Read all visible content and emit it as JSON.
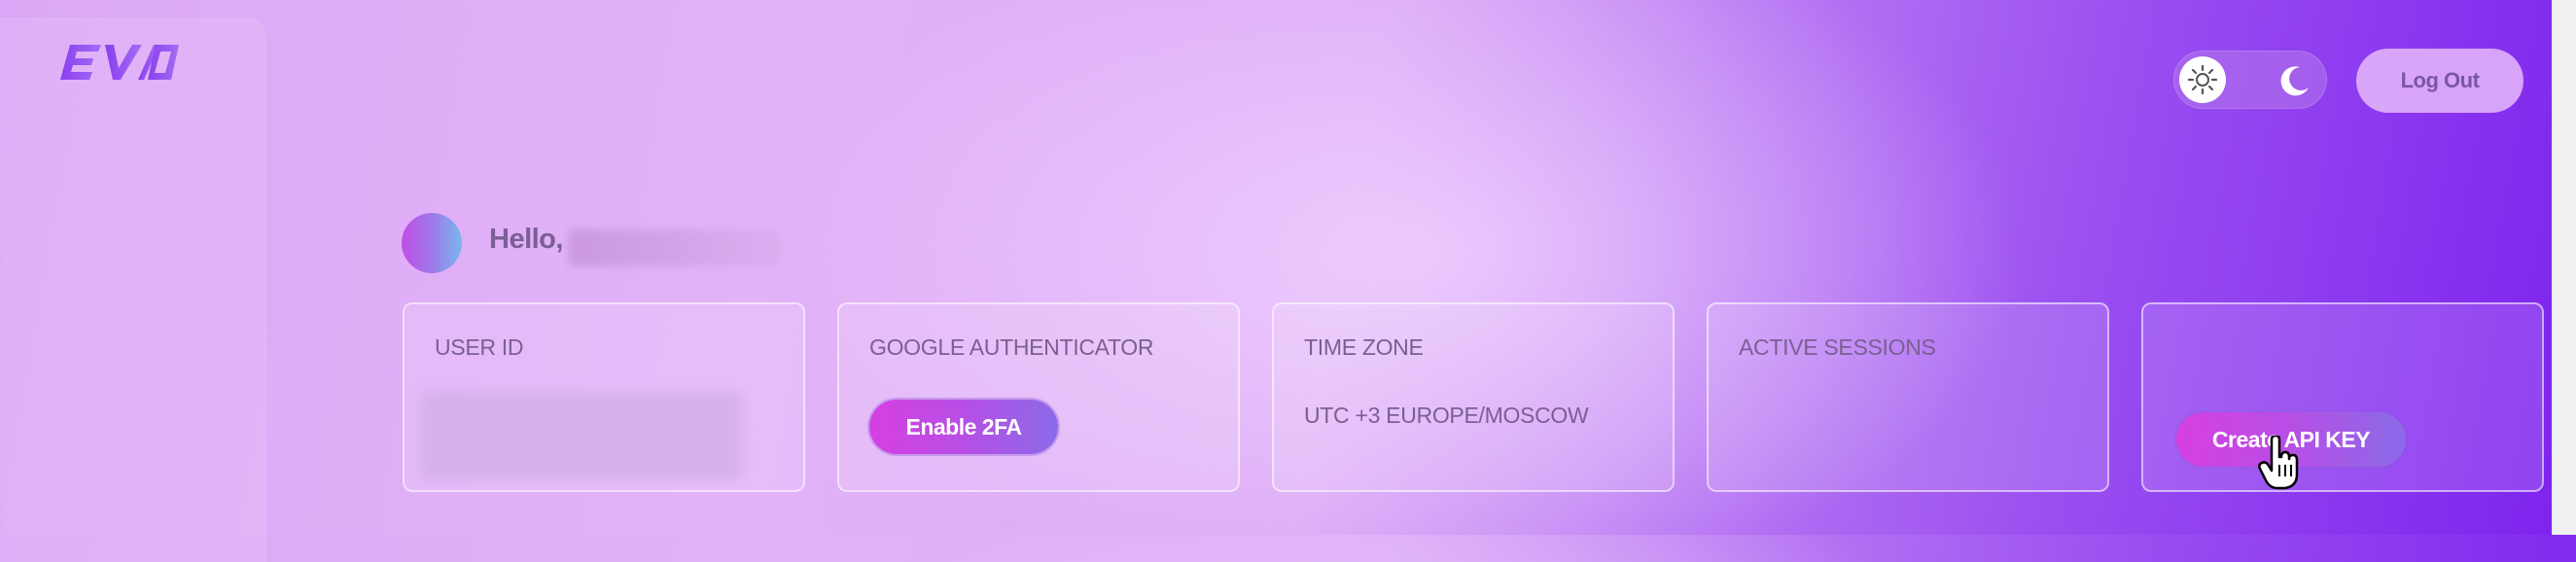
{
  "brand": {
    "logo_text": "EVO"
  },
  "header": {
    "theme_toggle": {
      "light_icon": "sun-icon",
      "dark_icon": "moon-icon",
      "selected": "light"
    },
    "logout_label": "Log Out"
  },
  "greeting": {
    "hello_text": "Hello,"
  },
  "cards": {
    "user_id": {
      "title": "USER ID"
    },
    "google_auth": {
      "title": "GOOGLE AUTHENTICATOR",
      "button_label": "Enable 2FA"
    },
    "time_zone": {
      "title": "TIME ZONE",
      "value": "UTC +3 EUROPE/MOSCOW"
    },
    "active_sessions": {
      "title": "ACTIVE SESSIONS"
    },
    "api_key": {
      "button_label": "Create API KEY"
    }
  },
  "colors": {
    "accent_start": "#d63fe2",
    "accent_end": "#8a6be8",
    "text": "#7a5f93",
    "background_end": "#7d22ee"
  }
}
